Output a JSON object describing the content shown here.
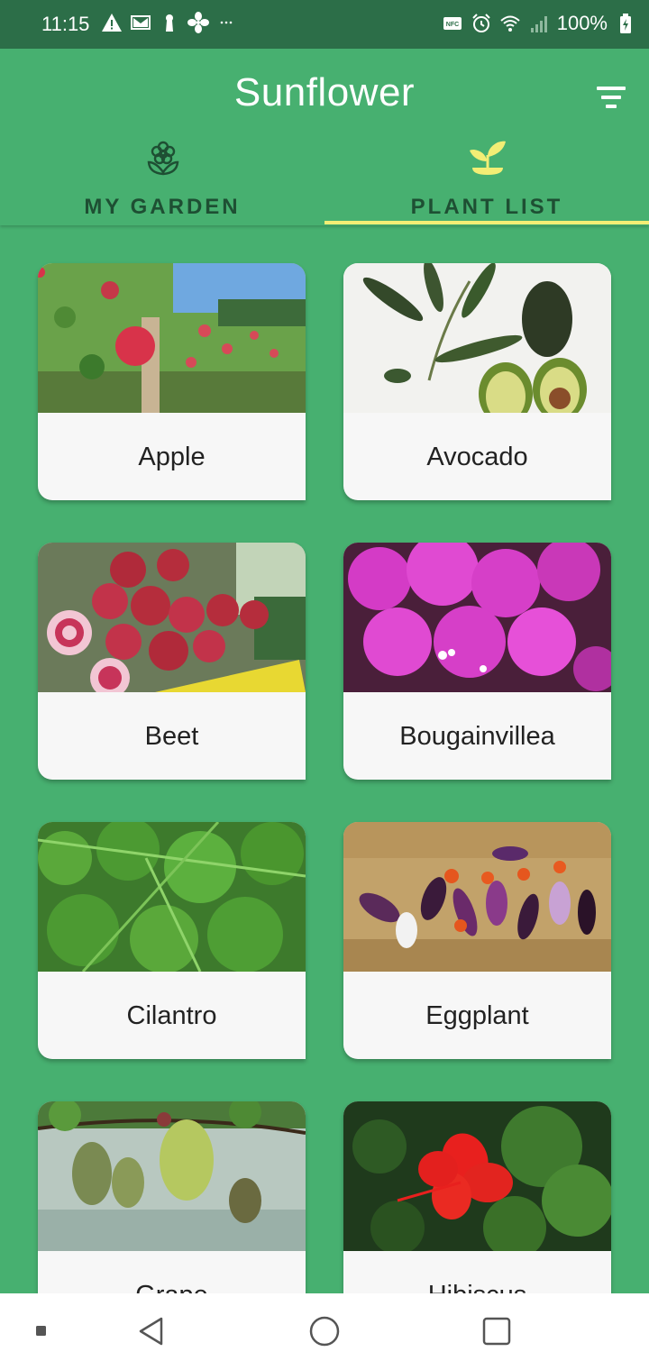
{
  "status_bar": {
    "time": "11:15",
    "battery": "100%",
    "left_icons": [
      "warning-icon",
      "gmail-icon",
      "keyhole-icon",
      "fan-icon",
      "more-dots-icon"
    ],
    "right_icons": [
      "nfc-icon",
      "alarm-icon",
      "wifi-icon",
      "signal-icon",
      "battery-icon"
    ]
  },
  "app_bar": {
    "title": "Sunflower",
    "filter_icon": "filter-list-icon",
    "background": "#47b070"
  },
  "tabs": [
    {
      "label": "MY GARDEN",
      "icon": "flower-icon",
      "selected": false
    },
    {
      "label": "PLANT LIST",
      "icon": "sprout-icon",
      "selected": true
    }
  ],
  "colors": {
    "accent": "#f3ee75",
    "primary": "#47b070",
    "status_bar": "#2c6e48",
    "tab_text": "#1e4f33"
  },
  "plants": [
    {
      "name": "Apple"
    },
    {
      "name": "Avocado"
    },
    {
      "name": "Beet"
    },
    {
      "name": "Bougainvillea"
    },
    {
      "name": "Cilantro"
    },
    {
      "name": "Eggplant"
    },
    {
      "name": "Grape"
    },
    {
      "name": "Hibiscus"
    }
  ],
  "nav_bar": {
    "buttons": [
      "menu-square-icon",
      "back-icon",
      "home-icon",
      "recents-icon"
    ]
  }
}
